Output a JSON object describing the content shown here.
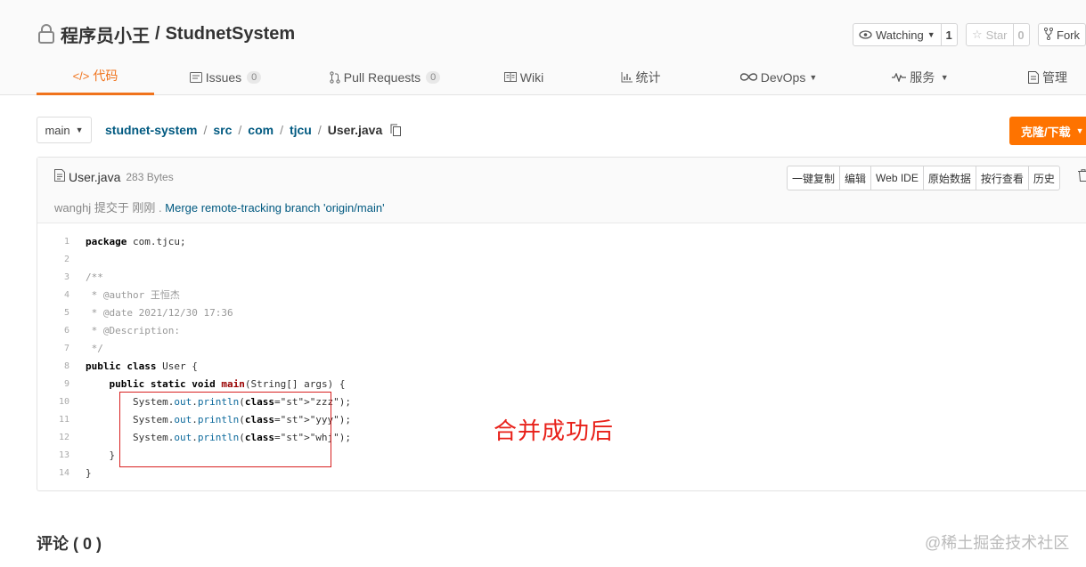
{
  "repo": {
    "owner": "程序员小王",
    "separator": "/",
    "name": "StudnetSystem"
  },
  "header_buttons": {
    "watching_label": "Watching",
    "watching_count": "1",
    "star_label": "Star",
    "star_count": "0",
    "fork_label": "Fork"
  },
  "tabs": [
    {
      "label": "代码",
      "icon": "code-icon",
      "active": true
    },
    {
      "label": "Issues",
      "badge": "0",
      "icon": "issues-icon"
    },
    {
      "label": "Pull Requests",
      "badge": "0",
      "icon": "pull-request-icon"
    },
    {
      "label": "Wiki",
      "icon": "wiki-icon"
    },
    {
      "label": "统计",
      "icon": "stats-icon"
    },
    {
      "label": "DevOps",
      "icon": "devops-icon"
    },
    {
      "label": "服务",
      "icon": "service-icon"
    },
    {
      "label": "管理",
      "icon": "manage-icon"
    }
  ],
  "branch": "main",
  "breadcrumb": {
    "parts": [
      "studnet-system",
      "src",
      "com",
      "tjcu"
    ],
    "current": "User.java"
  },
  "clone_label": "克隆/下载",
  "file": {
    "name": "User.java",
    "size": "283 Bytes",
    "author": "wanghj",
    "commit_prefix": " 提交于 刚刚 . ",
    "commit_message": "Merge remote-tracking branch 'origin/main'",
    "actions": [
      "一键复制",
      "编辑",
      "Web IDE",
      "原始数据",
      "按行查看",
      "历史"
    ]
  },
  "code_lines": [
    {
      "n": "1",
      "text": "package com.tjcu;"
    },
    {
      "n": "2",
      "text": ""
    },
    {
      "n": "3",
      "text": "/**"
    },
    {
      "n": "4",
      "text": " * @author 王恒杰"
    },
    {
      "n": "5",
      "text": " * @date 2021/12/30 17:36"
    },
    {
      "n": "6",
      "text": " * @Description:"
    },
    {
      "n": "7",
      "text": " */"
    },
    {
      "n": "8",
      "text": "public class User {"
    },
    {
      "n": "9",
      "text": "    public static void main(String[] args) {"
    },
    {
      "n": "10",
      "text": "        System.out.println(\"zzz\");"
    },
    {
      "n": "11",
      "text": "        System.out.println(\"yyy\");"
    },
    {
      "n": "12",
      "text": "        System.out.println(\"whj\");"
    },
    {
      "n": "13",
      "text": "    }"
    },
    {
      "n": "14",
      "text": "}"
    }
  ],
  "annotation": "合并成功后",
  "comments_title": "评论 ( 0 )",
  "watermark": "@稀土掘金技术社区",
  "colors": {
    "accent": "#f0731c",
    "clone_button": "#fe7300",
    "link": "#005980",
    "annotation": "#e8211a"
  }
}
